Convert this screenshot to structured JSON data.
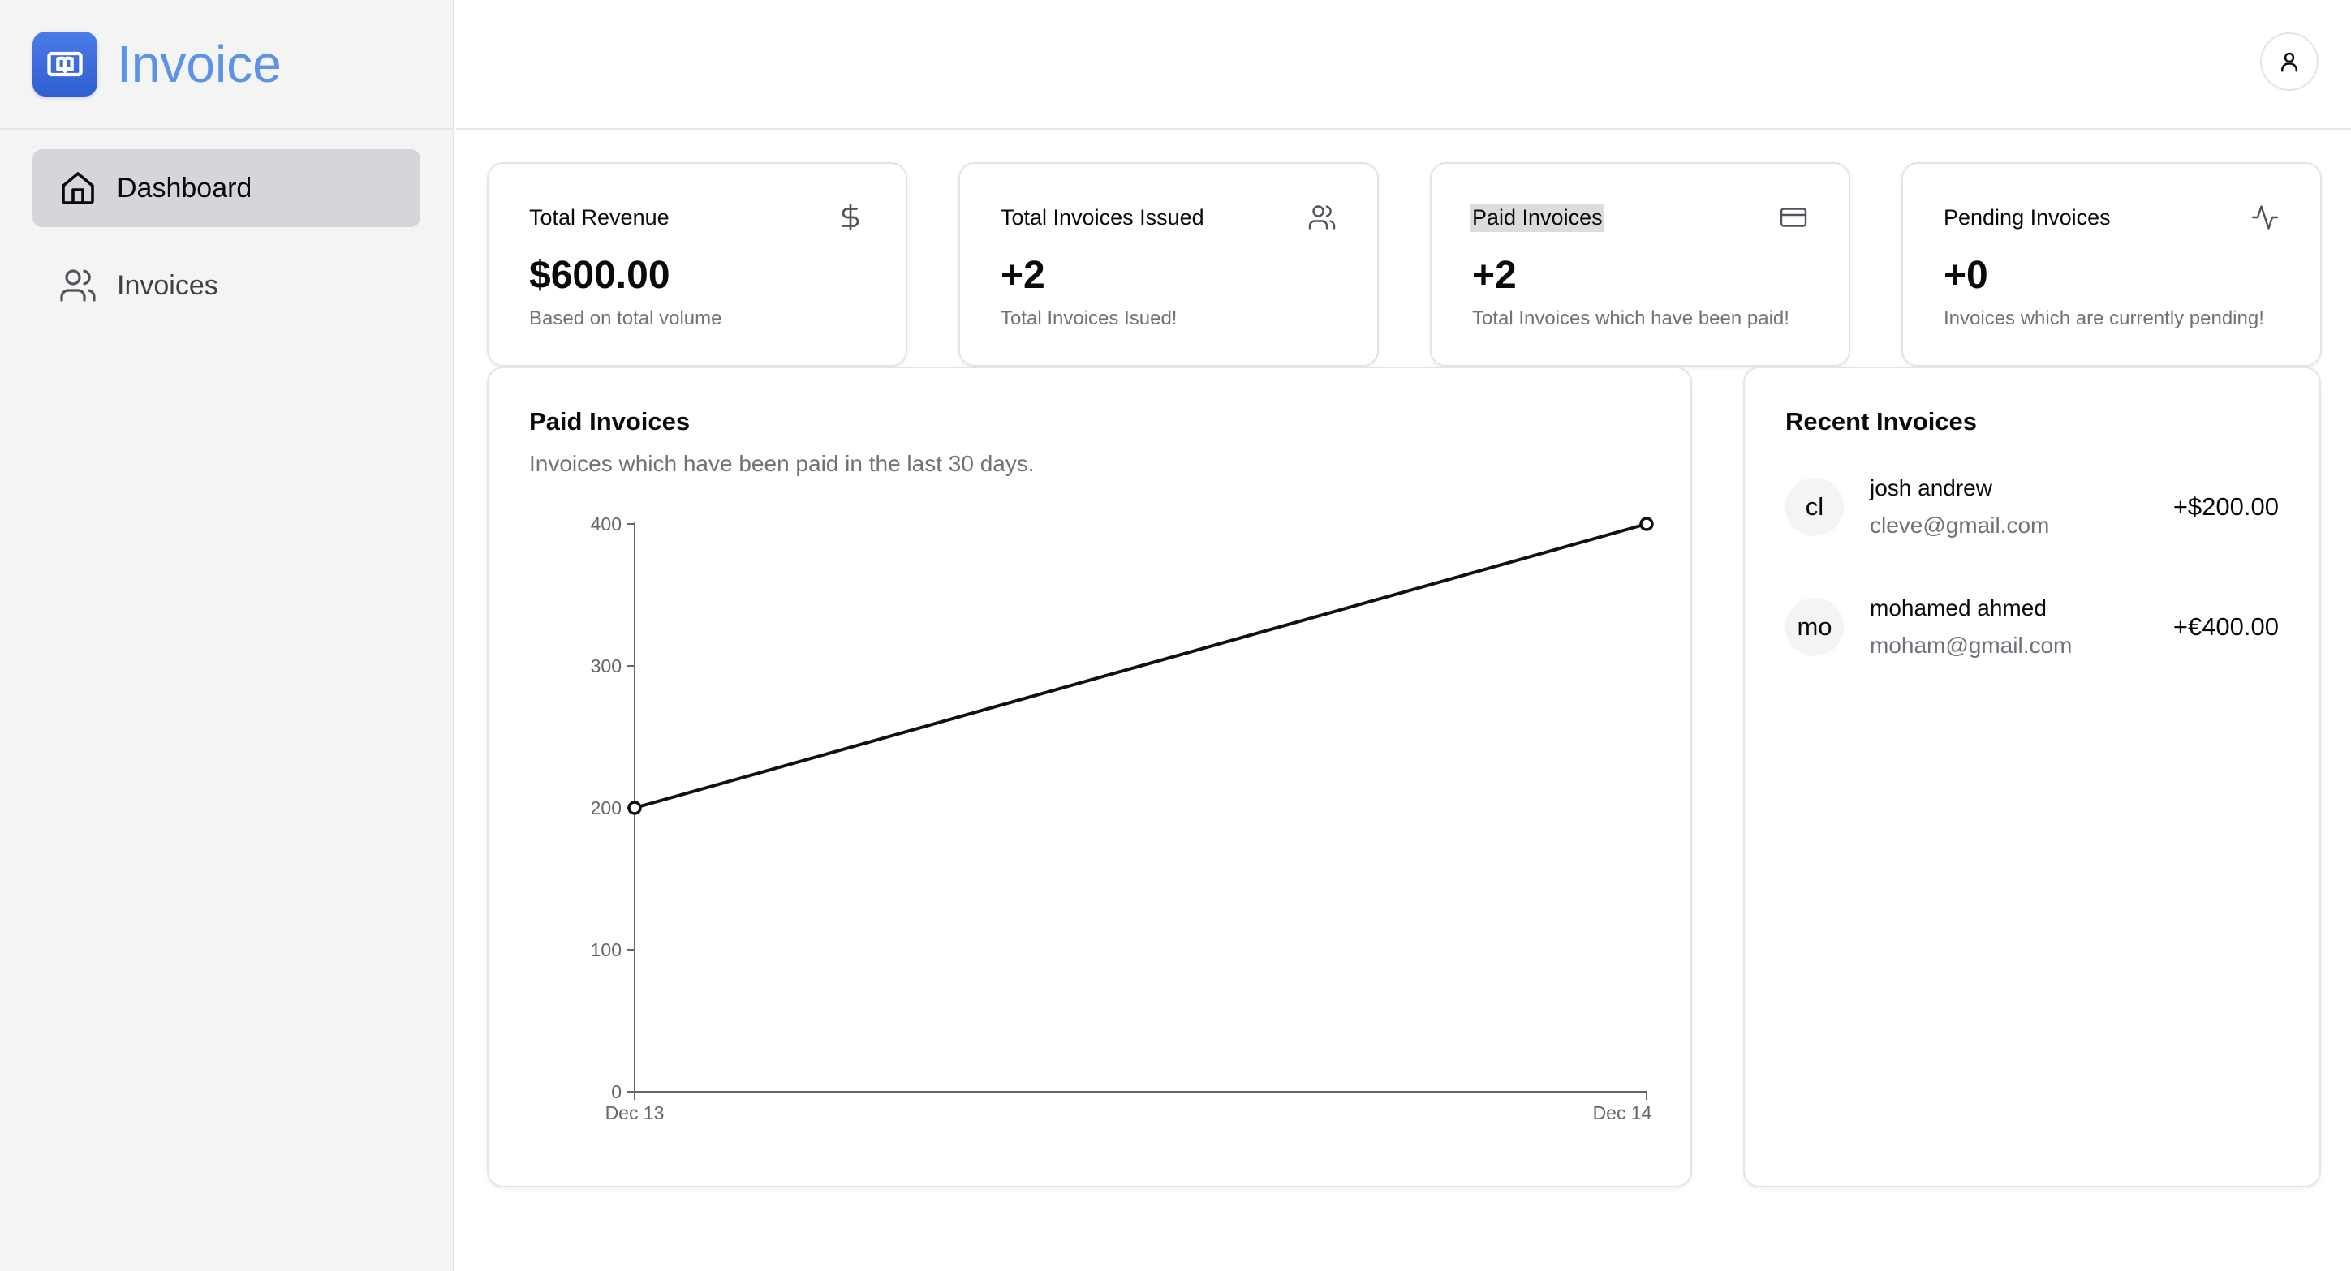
{
  "app": {
    "name": "Invoice",
    "brand_color": "#5b93e6",
    "logo_icon": "book-open-icon"
  },
  "sidebar": {
    "items": [
      {
        "label": "Dashboard",
        "icon": "home-icon",
        "active": true
      },
      {
        "label": "Invoices",
        "icon": "users-icon",
        "active": false
      }
    ]
  },
  "header": {
    "profile_icon": "user-icon"
  },
  "stats": [
    {
      "title": "Total Revenue",
      "value": "$600.00",
      "sub": "Based on total volume",
      "icon": "dollar-icon"
    },
    {
      "title": "Total Invoices Issued",
      "value": "+2",
      "sub": "Total Invoices Isued!",
      "icon": "users-icon"
    },
    {
      "title": "Paid Invoices",
      "value": "+2",
      "sub": "Total Invoices which have been paid!",
      "icon": "credit-card-icon"
    },
    {
      "title": "Pending Invoices",
      "value": "+0",
      "sub": "Invoices which are currently pending!",
      "icon": "activity-icon"
    }
  ],
  "chart_card": {
    "title": "Paid Invoices",
    "description": "Invoices which have been paid in the last 30 days."
  },
  "chart_data": {
    "type": "line",
    "x": [
      "Dec 13",
      "Dec 14"
    ],
    "series": [
      {
        "values": [
          200,
          400
        ]
      }
    ],
    "ylim": [
      0,
      400
    ],
    "yticks": [
      0,
      100,
      200,
      300,
      400
    ],
    "xlabel": "",
    "ylabel": "",
    "grid": false,
    "line_color": "#111111"
  },
  "recent": {
    "title": "Recent Invoices",
    "items": [
      {
        "initials": "cl",
        "name": "josh andrew",
        "email": "cleve@gmail.com",
        "amount": "+$200.00"
      },
      {
        "initials": "mo",
        "name": "mohamed ahmed",
        "email": "moham@gmail.com",
        "amount": "+€400.00"
      }
    ]
  }
}
